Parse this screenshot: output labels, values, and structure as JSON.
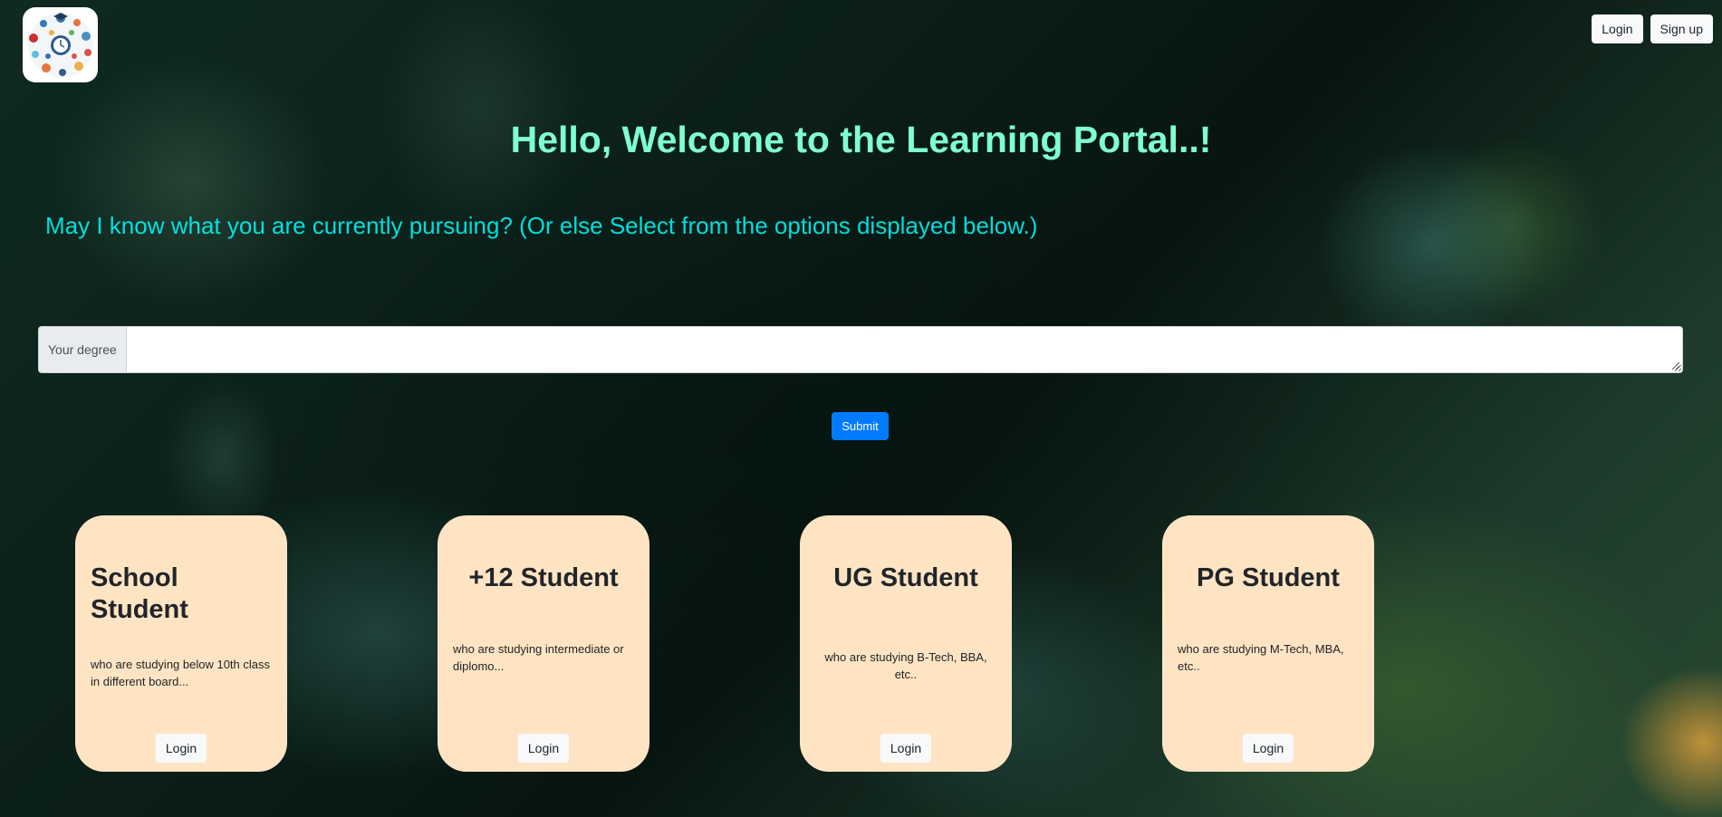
{
  "header": {
    "login_label": "Login",
    "signup_label": "Sign up"
  },
  "hero": {
    "title": "Hello, Welcome to the Learning Portal..!",
    "subtitle": "May I know what you are currently pursuing? (Or else Select from the options displayed below.)"
  },
  "degree_form": {
    "label": "Your degree",
    "value": "",
    "placeholder": "",
    "submit_label": "Submit"
  },
  "cards": [
    {
      "title": "School Student",
      "description": "who are studying below 10th class in different board...",
      "button_label": "Login"
    },
    {
      "title": "+12 Student",
      "description": "who are studying intermediate or diplomo...",
      "button_label": "Login"
    },
    {
      "title": "UG Student",
      "description": "who are studying B-Tech, BBA, etc..",
      "button_label": "Login"
    },
    {
      "title": "PG Student",
      "description": "who are studying M-Tech, MBA, etc..",
      "button_label": "Login"
    }
  ],
  "colors": {
    "title": "#7fffd4",
    "subtitle": "#00ffff",
    "card_background": "#ffe4c4",
    "primary_button": "#007bff"
  },
  "icons": {
    "logo": "education-collage-logo"
  }
}
